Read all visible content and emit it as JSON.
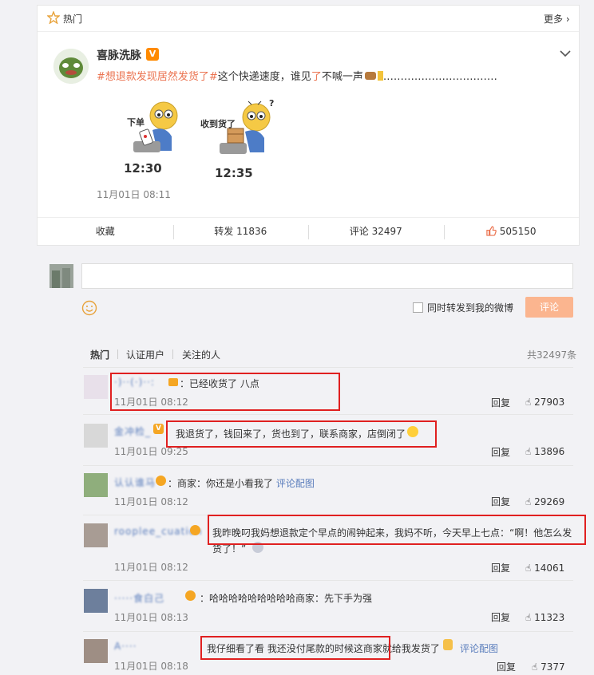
{
  "post": {
    "hot_label": "热门",
    "more_label": "更多",
    "author": "喜脉洗脉",
    "verified_mark": "V",
    "hashtag": "#想退款发现居然发货了#",
    "text_part1": "这个快递速度，谁见",
    "text_highlight": "了",
    "text_part2": "不喊一声",
    "text_dots": "……………………………",
    "comic_left_label": "下单",
    "comic_left_time": "12:30",
    "comic_right_label": "收到货了",
    "comic_right_time": "12:35",
    "comic_question": "?",
    "timestamp": "11月01日 08:11"
  },
  "actions": {
    "collect": "收藏",
    "forward": "转发 11836",
    "comment": "评论 32497",
    "like": "505150"
  },
  "composer": {
    "placeholder": "",
    "forward_option": "同时转发到我的微博",
    "submit": "评论"
  },
  "filters": {
    "hot": "热门",
    "verified": "认证用户",
    "following": "关注的人",
    "total": "共32497条"
  },
  "comments": [
    {
      "name": "·)··(·)··:",
      "text": "：已经收货了 八点",
      "time": "11月01日 08:12",
      "reply": "回复",
      "likes": "27903"
    },
    {
      "name": "金冲检_",
      "text": "我退货了，钱回来了，货也到了，联系商家，店倒闭了",
      "time": "11月01日 09:25",
      "reply": "回复",
      "likes": "13896"
    },
    {
      "name": "认认谁马",
      "text": "：商家：你还是小看我了",
      "link": "评论配图",
      "time": "11月01日 08:12",
      "reply": "回复",
      "likes": "29269"
    },
    {
      "name": "rooplee_cuation",
      "text": "我昨晚叼我妈想退款定个早点的闹钟起来，我妈不听，今天早上七点：“啊！他怎么发",
      "text2": "货了！”",
      "time": "11月01日 08:12",
      "reply": "回复",
      "likes": "14061"
    },
    {
      "name": "·····食白己",
      "text": "：哈哈哈哈哈哈哈哈哈商家：先下手为强",
      "time": "11月01日 08:13",
      "reply": "回复",
      "likes": "11323"
    },
    {
      "name": "A····",
      "text": "我仔细看了看 我还没付尾款的时候这商家就给我发货了",
      "link": "评论配图",
      "time": "11月01日 08:18",
      "reply": "回复",
      "likes": "7377"
    }
  ],
  "icons": {
    "star": "star-icon",
    "chevron": "chevron-down-icon",
    "thumb": "thumb-up-icon",
    "smile": "smile-icon"
  },
  "colors": {
    "accent": "#eb7350",
    "link": "#5a7dbc",
    "highlight_box": "#e02020"
  }
}
